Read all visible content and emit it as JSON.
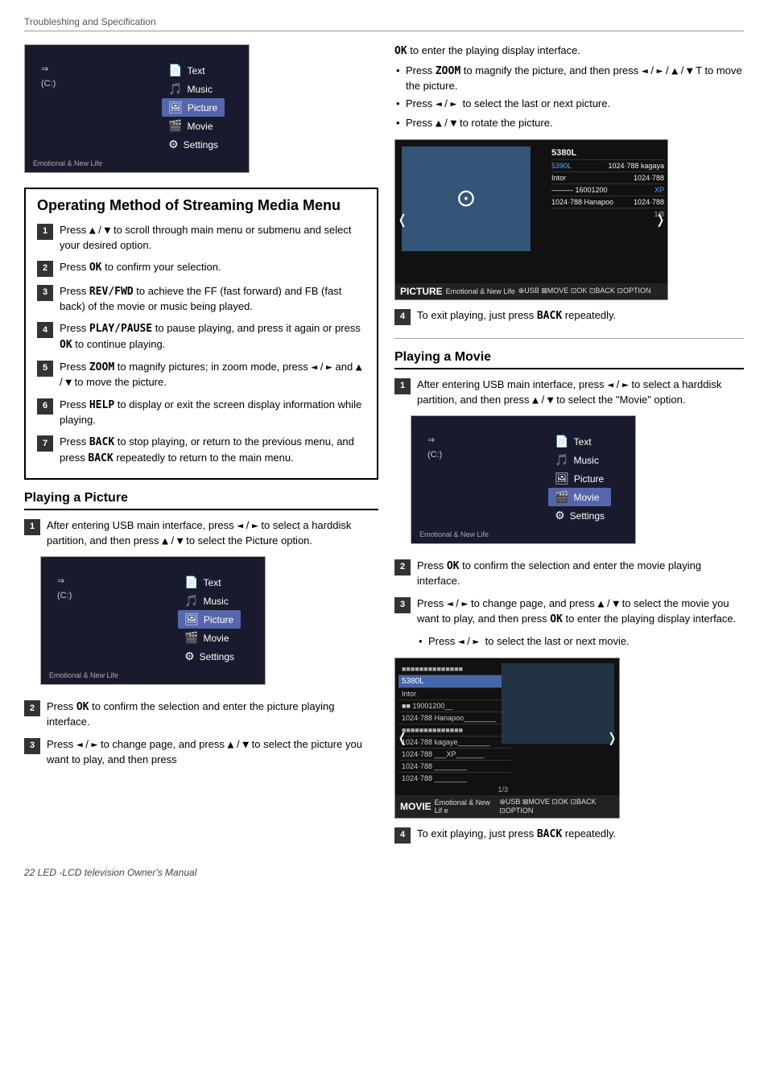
{
  "header": {
    "breadcrumb": "Troubleshing and Specification"
  },
  "footer": {
    "text": "22   LED -LCD television  Owner's Manual"
  },
  "usb_menu_top": {
    "drives": [
      "⇒",
      "(C:)"
    ],
    "menu_items": [
      "Text",
      "Music",
      "Picture",
      "Movie",
      "Settings"
    ],
    "selected": "Picture",
    "bottom_label": "Emotional & New Life"
  },
  "streaming_section": {
    "title": "Operating Method of Streaming Media Menu",
    "steps": [
      {
        "num": "1",
        "text": "Press ▲ / ▼ to scroll through main menu or submenu and select your desired option."
      },
      {
        "num": "2",
        "text": "Press OK to confirm your selection."
      },
      {
        "num": "3",
        "text": "Press REV/FWD to achieve the FF (fast forward) and FB (fast back) of the movie or music being played."
      },
      {
        "num": "4",
        "text": "Press PLAY/PAUSE to pause playing, and press it again or press OK to continue playing."
      },
      {
        "num": "5",
        "text": "Press ZOOM to magnify pictures; in zoom mode, press ◄ / ► and ▲ / ▼ to move the picture."
      },
      {
        "num": "6",
        "text": "Press HELP to display or exit the screen display information while playing."
      },
      {
        "num": "7",
        "text": "Press BACK to stop playing, or return to the previous menu, and press BACK repeatedly to return to the main menu."
      }
    ]
  },
  "playing_picture_section": {
    "title": "Playing a Picture",
    "steps": [
      {
        "num": "1",
        "text": "After entering USB main interface, press ◄ / ► to select a harddisk partition, and then press ▲ / ▼ to select the Picture option."
      },
      {
        "num": "2",
        "text": "Press OK to confirm the selection and enter the picture playing interface."
      },
      {
        "num": "3",
        "text": "Press ◄ / ► to change page, and press ▲ / ▼ to select the picture you want to play, and then press"
      }
    ]
  },
  "usb_menu_picture": {
    "drives": [
      "⇒",
      "(C:)"
    ],
    "menu_items": [
      "Text",
      "Music",
      "Picture",
      "Movie",
      "Settings"
    ],
    "selected": "Picture",
    "bottom_label": "Emotional & New Life"
  },
  "right_col": {
    "ok_text": "OK to enter the playing display interface.",
    "bullets": [
      "Press ZOOM to magnify the picture, and then press ◄ / ► / ▲ / ▼ T to move the picture.",
      "Press ◄ / ► to select the last or next picture.",
      "Press ▲ / ▼ to rotate the picture."
    ],
    "step4_text": "To exit playing, just press BACK repeatedly.",
    "picture_screen": {
      "title": "5380L",
      "info_rows": [
        [
          "5390L",
          "1024·788 kagaya"
        ],
        [
          "Infor",
          "1024·788"
        ],
        [
          "———— 16001200",
          "XP"
        ],
        [
          "1024·788 Hanapoo",
          "1024·788"
        ],
        [
          "",
          "1/8"
        ]
      ],
      "bottom": "PICTURE  Emotional & New Life  ⊕USB  ⊠MOVE ⊡OK  ⊡BACK  ⊡OPTION"
    }
  },
  "playing_movie_section": {
    "title": "Playing a Movie",
    "steps": [
      {
        "num": "1",
        "text": "After entering USB main interface, press ◄ / ► to select a harddisk partition, and then press ▲ / ▼ to select the \"Movie\" option."
      },
      {
        "num": "2",
        "text": "Press OK to confirm the selection and enter the movie playing interface."
      },
      {
        "num": "3",
        "text": "Press ◄ / ► to change page, and press ▲ / ▼ to select the movie you want to play, and then press OK to enter the playing display interface."
      }
    ],
    "bullet_movie": "Press ◄ / ► to select the last or next movie.",
    "step4_text": "To exit playing, just press BACK repeatedly.",
    "usb_menu": {
      "drives": [
        "⇒",
        "(C:)"
      ],
      "menu_items": [
        "Text",
        "Music",
        "Picture",
        "Movie",
        "Settings"
      ],
      "selected": "Movie",
      "bottom_label": "Emotional & New Life"
    },
    "movie_screen": {
      "title": "5380L",
      "file_rows": [
        "■■■■■■■■■■■■■■■",
        "5380L",
        "Intor",
        "■■ 19001200__",
        "1024·788 Hanapoo________",
        "■■■■■■■■■■■■■■■",
        "1024·788 kagaye________",
        "1024·788 ___XP_______",
        "1024·788 ________",
        "1024·788 ________",
        "1/3"
      ],
      "bottom": "MOVIE  Emotional & New Lif e  ⊕USB  ⊠MOVE ⊡OK  ⊡BACK  ⊡OPTION"
    }
  }
}
